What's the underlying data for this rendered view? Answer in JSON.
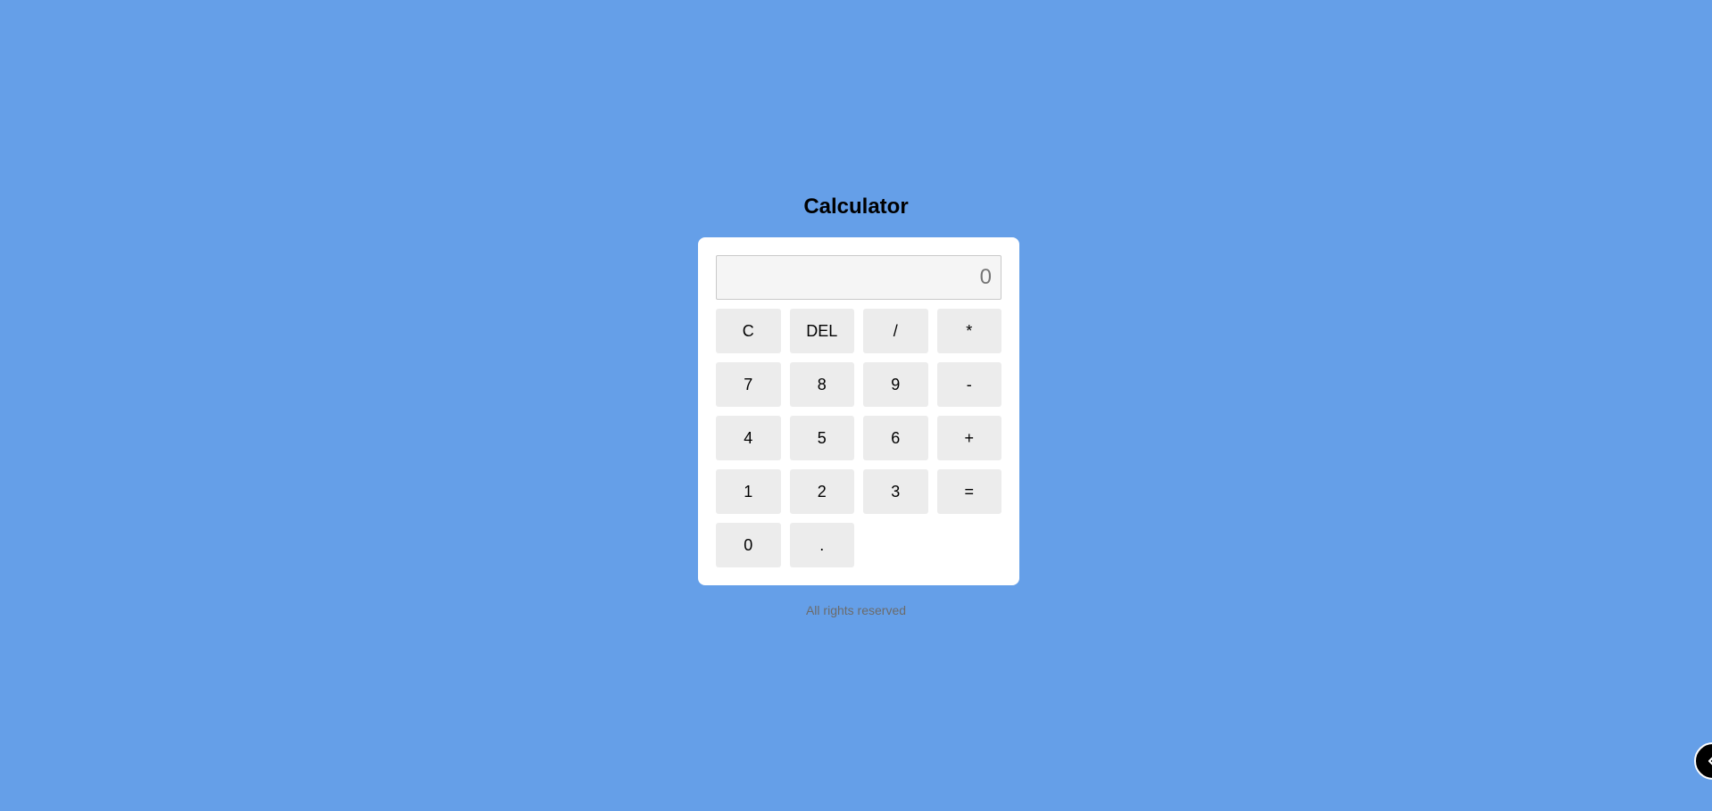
{
  "page": {
    "title": "Calculator",
    "footer": "All rights reserved"
  },
  "display": {
    "placeholder": "0"
  },
  "keys": {
    "clear": "C",
    "delete": "DEL",
    "divide": "/",
    "multiply": "*",
    "seven": "7",
    "eight": "8",
    "nine": "9",
    "subtract": "-",
    "four": "4",
    "five": "5",
    "six": "6",
    "add": "+",
    "one": "1",
    "two": "2",
    "three": "3",
    "equals": "=",
    "zero": "0",
    "decimal": "."
  },
  "icons": {
    "corner": "chevron-left-icon"
  },
  "colors": {
    "background": "#659fe8",
    "card": "#ffffff",
    "key": "#ececec",
    "display": "#f5f5f5"
  }
}
